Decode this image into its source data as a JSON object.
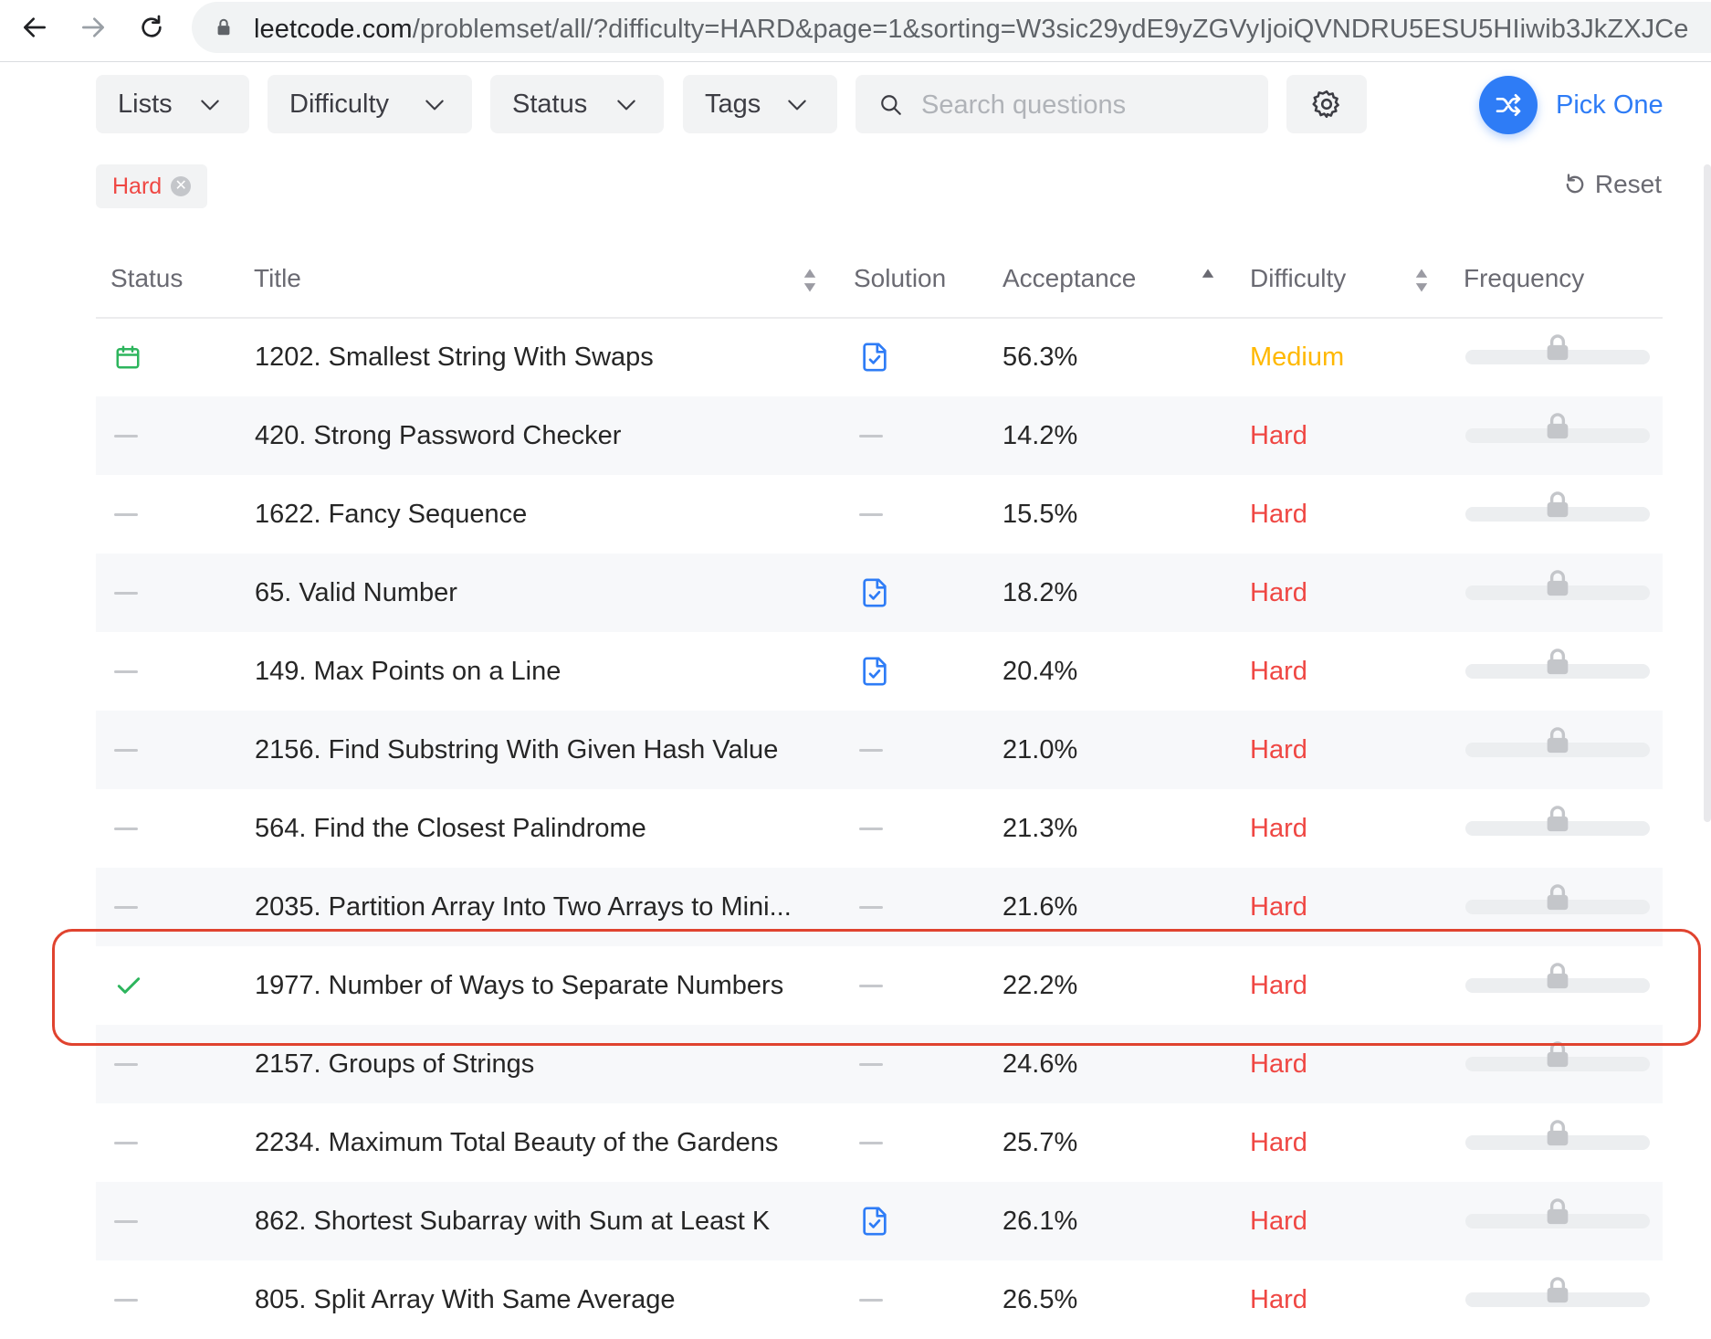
{
  "browser": {
    "url_host": "leetcode.com",
    "url_path": "/problemset/all/?difficulty=HARD&page=1&sorting=W3sic29ydE9yZGVyIjoiQVNDRU5ESU5HIiwib3JkZXJCe"
  },
  "toolbar": {
    "filters": [
      "Lists",
      "Difficulty",
      "Status",
      "Tags"
    ],
    "search_placeholder": "Search questions",
    "pick_one_label": "Pick One"
  },
  "active_filter": {
    "chip_label": "Hard",
    "reset_label": "Reset"
  },
  "table": {
    "headers": [
      "Status",
      "Title",
      "Solution",
      "Acceptance",
      "Difficulty",
      "Frequency"
    ],
    "colors": {
      "medium": "#ffb800",
      "hard": "#ef4743",
      "solution_icon": "#2e7cf6",
      "solved": "#2db55d"
    },
    "rows": [
      {
        "status": "calendar",
        "title": "1202. Smallest String With Swaps",
        "solution": true,
        "acceptance": "56.3%",
        "difficulty": "Medium"
      },
      {
        "status": "none",
        "title": "420. Strong Password Checker",
        "solution": false,
        "acceptance": "14.2%",
        "difficulty": "Hard"
      },
      {
        "status": "none",
        "title": "1622. Fancy Sequence",
        "solution": false,
        "acceptance": "15.5%",
        "difficulty": "Hard"
      },
      {
        "status": "none",
        "title": "65. Valid Number",
        "solution": true,
        "acceptance": "18.2%",
        "difficulty": "Hard"
      },
      {
        "status": "none",
        "title": "149. Max Points on a Line",
        "solution": true,
        "acceptance": "20.4%",
        "difficulty": "Hard"
      },
      {
        "status": "none",
        "title": "2156. Find Substring With Given Hash Value",
        "solution": false,
        "acceptance": "21.0%",
        "difficulty": "Hard"
      },
      {
        "status": "none",
        "title": "564. Find the Closest Palindrome",
        "solution": false,
        "acceptance": "21.3%",
        "difficulty": "Hard"
      },
      {
        "status": "none",
        "title": "2035. Partition Array Into Two Arrays to Mini...",
        "solution": false,
        "acceptance": "21.6%",
        "difficulty": "Hard"
      },
      {
        "status": "solved",
        "title": "1977. Number of Ways to Separate Numbers",
        "solution": false,
        "acceptance": "22.2%",
        "difficulty": "Hard"
      },
      {
        "status": "none",
        "title": "2157. Groups of Strings",
        "solution": false,
        "acceptance": "24.6%",
        "difficulty": "Hard"
      },
      {
        "status": "none",
        "title": "2234. Maximum Total Beauty of the Gardens",
        "solution": false,
        "acceptance": "25.7%",
        "difficulty": "Hard"
      },
      {
        "status": "none",
        "title": "862. Shortest Subarray with Sum at Least K",
        "solution": true,
        "acceptance": "26.1%",
        "difficulty": "Hard"
      },
      {
        "status": "none",
        "title": "805. Split Array With Same Average",
        "solution": false,
        "acceptance": "26.5%",
        "difficulty": "Hard"
      }
    ]
  }
}
